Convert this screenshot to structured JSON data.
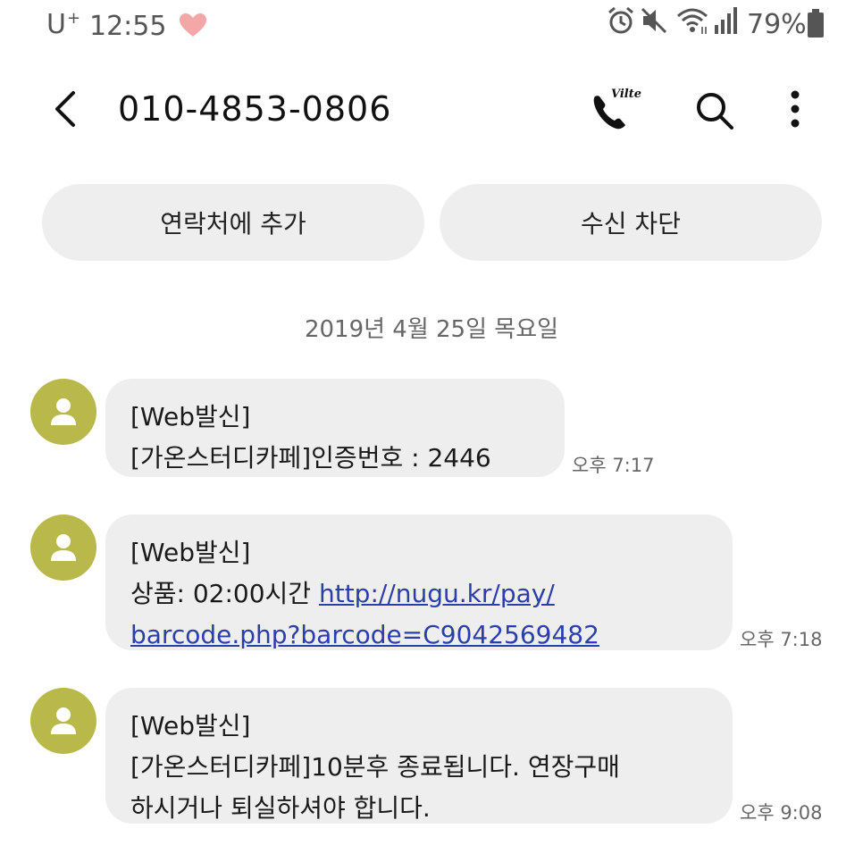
{
  "status_bar": {
    "carrier": "U",
    "carrier_sup": "+",
    "time": "12:55",
    "battery": "79%"
  },
  "header": {
    "title": "010-4853-0806",
    "vcall_badge": "Vilte"
  },
  "actions": {
    "add_contact": "연락처에 추가",
    "block": "수신 차단"
  },
  "date_separator": "2019년 4월 25일 목요일",
  "messages": [
    {
      "lines": [
        "[Web발신]",
        "[가온스터디카페]인증번호 : 2446"
      ],
      "time": "오후 7:17"
    },
    {
      "line1": "[Web발신]",
      "line2_text": "상품: 02:00시간 ",
      "link_part1": "http://nugu.kr/pay/",
      "link_part2": "barcode.php?barcode=C9042569482",
      "time": "오후 7:18"
    },
    {
      "lines": [
        "[Web발신]",
        "[가온스터디카페]10분후 종료됩니다. 연장구매",
        "하시거나 퇴실하셔야 합니다."
      ],
      "time": "오후 9:08"
    }
  ],
  "colors": {
    "bubble": "#eeeeee",
    "avatar": "#b8b94a",
    "link": "#2a3faa",
    "heart": "#f4a7a7"
  }
}
